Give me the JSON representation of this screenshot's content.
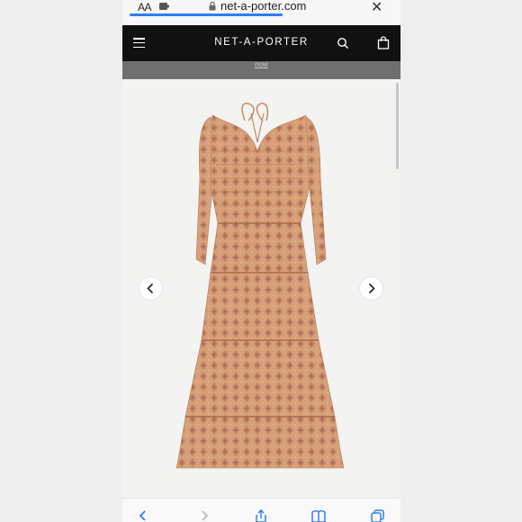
{
  "browser": {
    "text_size_label": "AA",
    "url": "net-a-porter.com",
    "close_symbol": "✕",
    "load_progress": 0.55
  },
  "site": {
    "logo": "NET-A-PORTER",
    "promo_link": "now"
  },
  "product": {
    "image_subject": "tiered floral-print maxi dress with halter tie, long sleeves",
    "image_index_hint": "carousel with previous and next controls"
  },
  "colors": {
    "header_bg": "#111111",
    "promo_bg": "#6f6f6f",
    "progress_blue": "#2f7df6",
    "toolbar_blue": "#2f7df6"
  }
}
